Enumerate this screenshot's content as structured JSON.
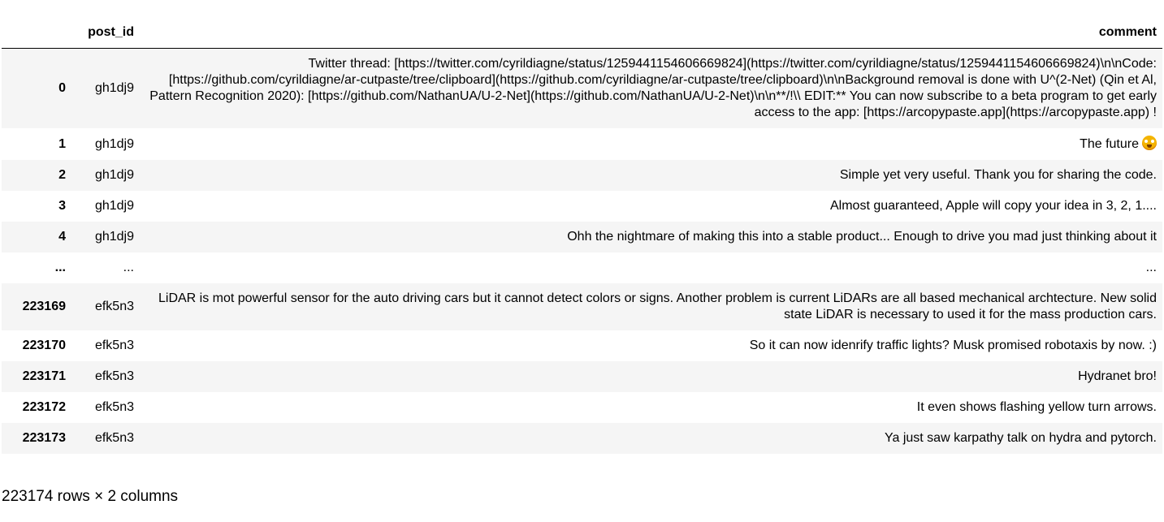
{
  "dataframe": {
    "columns": [
      "",
      "post_id",
      "comment"
    ],
    "rows": [
      {
        "index": "0",
        "post_id": "gh1dj9",
        "comment": "Twitter thread: [https://twitter.com/cyrildiagne/status/1259441154606669824](https://twitter.com/cyrildiagne/status/1259441154606669824)\\n\\nCode: [https://github.com/cyrildiagne/ar-cutpaste/tree/clipboard](https://github.com/cyrildiagne/ar-cutpaste/tree/clipboard)\\n\\nBackground removal is done with U^(2-Net) (Qin et Al, Pattern Recognition 2020): [https://github.com/NathanUA/U-2-Net](https://github.com/NathanUA/U-2-Net)\\n\\n**/!\\\\ EDIT:** You can now subscribe to a beta program to get early access to the app: [https://arcopypaste.app](https://arcopypaste.app) !"
      },
      {
        "index": "1",
        "post_id": "gh1dj9",
        "comment": "The future",
        "emoji": "exploding-head-icon"
      },
      {
        "index": "2",
        "post_id": "gh1dj9",
        "comment": "Simple yet very useful. Thank you for sharing the code."
      },
      {
        "index": "3",
        "post_id": "gh1dj9",
        "comment": "Almost guaranteed, Apple will copy your idea in 3, 2, 1...."
      },
      {
        "index": "4",
        "post_id": "gh1dj9",
        "comment": "Ohh the nightmare of making this into a stable product... Enough to drive you mad just thinking about it"
      },
      {
        "index": "...",
        "post_id": "...",
        "comment": "..."
      },
      {
        "index": "223169",
        "post_id": "efk5n3",
        "comment": "LiDAR is mot powerful sensor for the auto driving cars but it cannot detect colors or signs. Another problem is current LiDARs are all based mechanical archtecture. New solid state LiDAR is necessary to used it for the mass production cars."
      },
      {
        "index": "223170",
        "post_id": "efk5n3",
        "comment": "So it can now idenrify traffic lights? Musk promised robotaxis by now. :)"
      },
      {
        "index": "223171",
        "post_id": "efk5n3",
        "comment": "Hydranet bro!"
      },
      {
        "index": "223172",
        "post_id": "efk5n3",
        "comment": "It even shows flashing yellow turn arrows."
      },
      {
        "index": "223173",
        "post_id": "efk5n3",
        "comment": "Ya just saw karpathy talk on hydra and pytorch."
      }
    ],
    "shape_text": "223174 rows × 2 columns"
  },
  "colors": {
    "stripe": "#f5f5f5",
    "header_border": "#000000"
  }
}
